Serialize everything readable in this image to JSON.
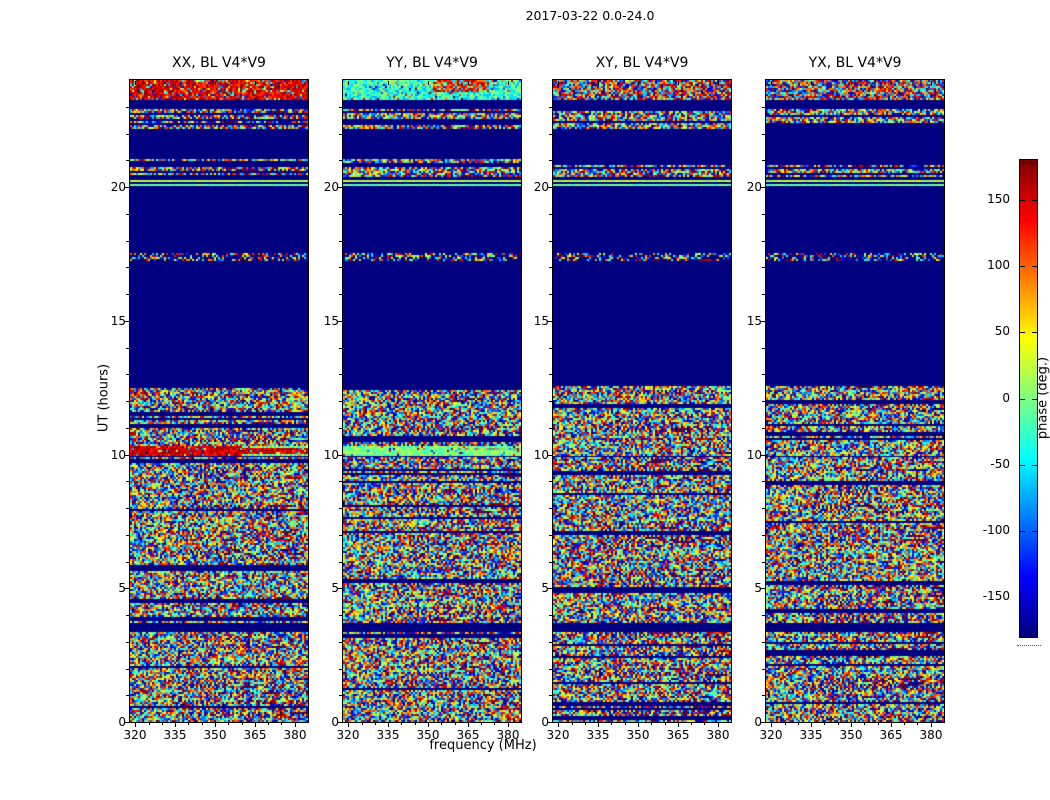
{
  "chart_data": {
    "type": "heatmap",
    "title": "2017-03-22 0.0-24.0",
    "panels": [
      {
        "label": "XX, BL V4*V9",
        "accent": "red",
        "top": "red"
      },
      {
        "label": "YY, BL V4*V9",
        "accent": "cyan",
        "top": "cyan_redpatch"
      },
      {
        "label": "XY, BL V4*V9",
        "accent": "none",
        "top": "mixed"
      },
      {
        "label": "YX, BL V4*V9",
        "accent": "none",
        "top": "mixed"
      }
    ],
    "xaxis": {
      "label": "frequency (MHz)",
      "range": [
        318,
        385
      ],
      "ticks": [
        320,
        335,
        350,
        365,
        380
      ],
      "minor_step": 5
    },
    "yaxis": {
      "label": "UT (hours)",
      "range": [
        0,
        24
      ],
      "ticks": [
        0,
        5,
        10,
        15,
        20
      ],
      "minor_step": 1
    },
    "colorbar": {
      "label": "phase (deg.)",
      "range": [
        -180,
        180
      ],
      "ticks": [
        150,
        100,
        50,
        0,
        -50,
        -100,
        -150
      ],
      "colormap": "jet"
    },
    "quiet_color": "#000080",
    "bands": [
      {
        "from": 0.0,
        "to": 3.35,
        "kind": "speckle"
      },
      {
        "from": 3.75,
        "to": 9.9,
        "kind": "speckle"
      },
      {
        "from": 9.95,
        "to": 10.3,
        "kind": "accent"
      },
      {
        "from": 10.35,
        "to": 12.55,
        "kind": "speckle"
      },
      {
        "from": 17.25,
        "to": 17.55,
        "kind": "sparse"
      },
      {
        "from": 20.15,
        "to": 20.3,
        "kind": "lines"
      },
      {
        "from": 20.4,
        "to": 21.2,
        "kind": "rows"
      },
      {
        "from": 22.2,
        "to": 22.9,
        "kind": "rows"
      },
      {
        "from": 23.3,
        "to": 24.0,
        "kind": "top"
      }
    ]
  }
}
